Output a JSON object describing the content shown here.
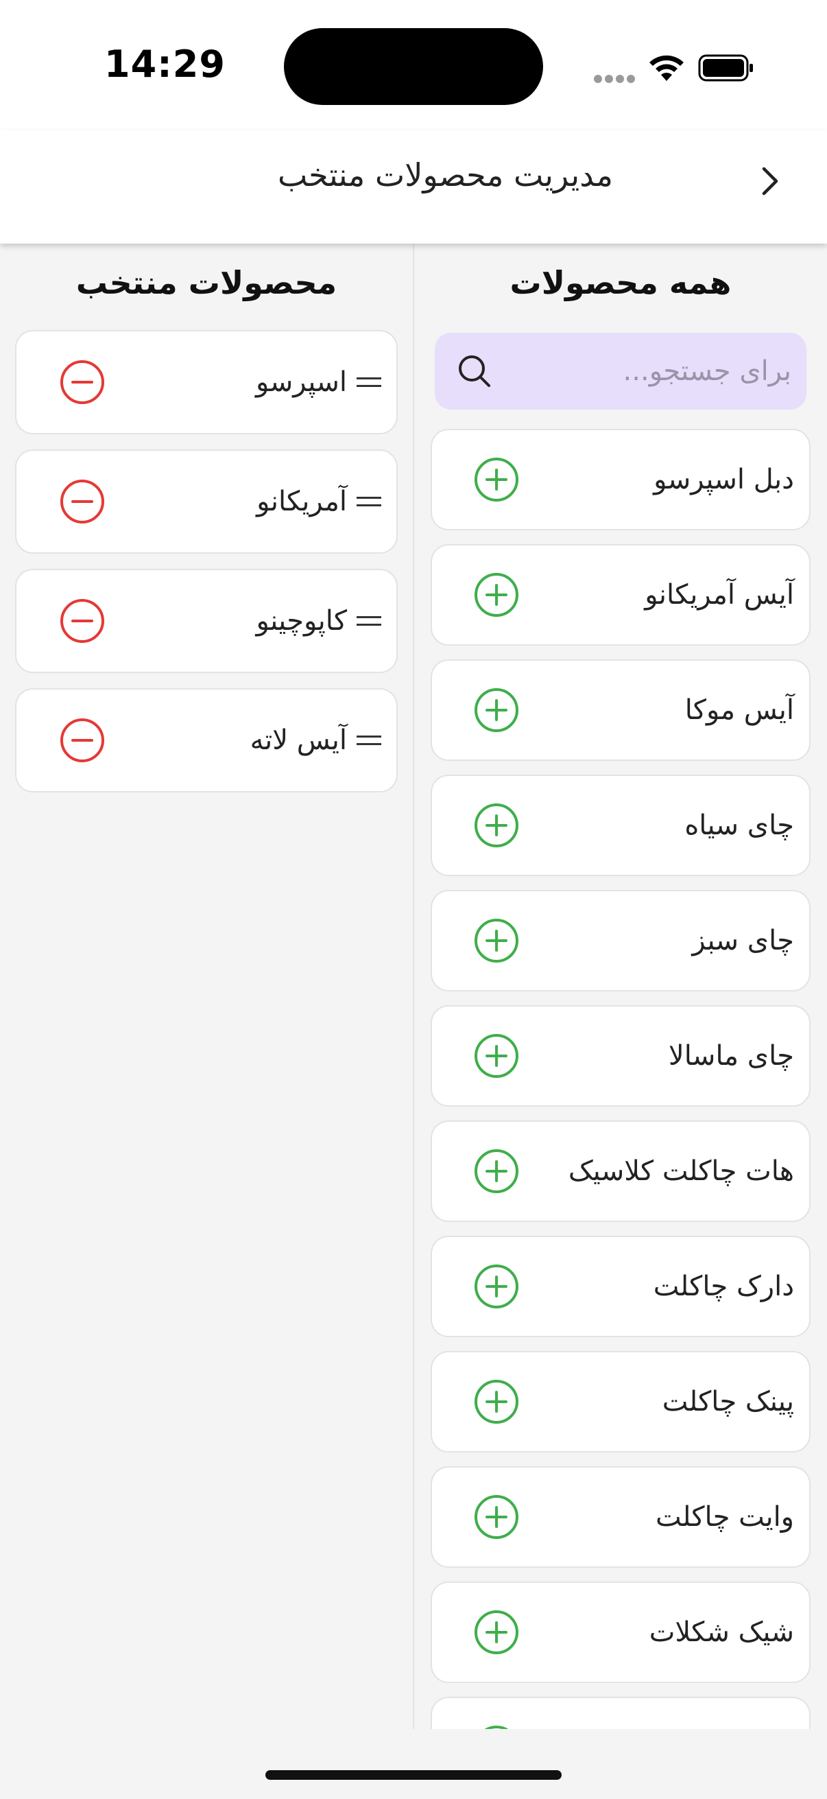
{
  "status_bar": {
    "time": "14:29"
  },
  "header": {
    "title": "مدیریت محصولات منتخب"
  },
  "all_products": {
    "title": "همه محصولات",
    "search_placeholder": "برای جستجو...",
    "items": [
      {
        "label": "دبل اسپرسو"
      },
      {
        "label": "آیس آمریکانو"
      },
      {
        "label": "آیس موکا"
      },
      {
        "label": "چای سیاه"
      },
      {
        "label": "چای سبز"
      },
      {
        "label": "چای ماسالا"
      },
      {
        "label": "هات چاکلت کلاسیک"
      },
      {
        "label": "دارک چاکلت"
      },
      {
        "label": "پینک چاکلت"
      },
      {
        "label": "وایت چاکلت"
      },
      {
        "label": "شیک شکلات"
      }
    ]
  },
  "selected_products": {
    "title": "محصولات منتخب",
    "items": [
      {
        "label": "اسپرسو"
      },
      {
        "label": "آمریکانو"
      },
      {
        "label": "کاپوچینو"
      },
      {
        "label": "آیس لاته"
      }
    ]
  },
  "colors": {
    "add": "#3fae4a",
    "remove": "#e53935",
    "search_bg": "#e6defa"
  }
}
